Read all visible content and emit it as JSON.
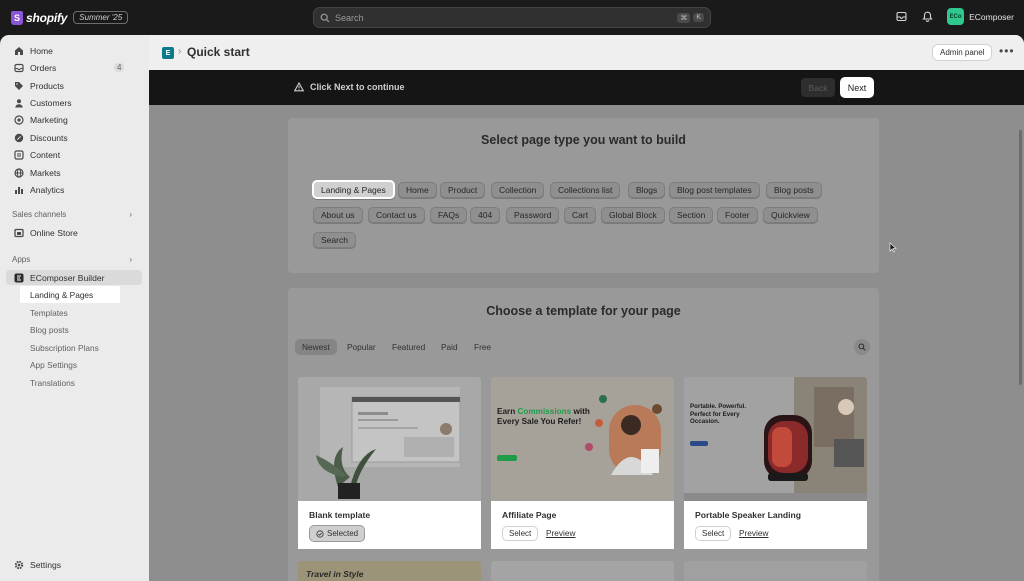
{
  "topbar": {
    "brand": "shopify",
    "edition_badge": "Summer '25",
    "search_placeholder": "Search",
    "kbd_cmd": "⌘",
    "kbd_k": "K",
    "store_avatar": "ECo",
    "store_name": "EComposer"
  },
  "sidebar": {
    "items": [
      {
        "label": "Home",
        "icon": "home-icon"
      },
      {
        "label": "Orders",
        "icon": "orders-icon",
        "badge": "4"
      },
      {
        "label": "Products",
        "icon": "tag-icon"
      },
      {
        "label": "Customers",
        "icon": "person-icon"
      },
      {
        "label": "Marketing",
        "icon": "target-icon"
      },
      {
        "label": "Discounts",
        "icon": "discount-icon"
      },
      {
        "label": "Content",
        "icon": "content-icon"
      },
      {
        "label": "Markets",
        "icon": "globe-icon"
      },
      {
        "label": "Analytics",
        "icon": "bar-chart-icon"
      }
    ],
    "sales_channels_label": "Sales channels",
    "online_store": "Online Store",
    "apps_label": "Apps",
    "app_name": "EComposer Builder",
    "app_sub_items": [
      "Landing & Pages",
      "Templates",
      "Blog posts",
      "Subscription Plans",
      "App Settings",
      "Translations"
    ],
    "settings": "Settings"
  },
  "header": {
    "title": "Quick start",
    "admin_panel": "Admin panel",
    "more": "•••"
  },
  "banner": {
    "text": "Click Next to continue",
    "back": "Back",
    "next": "Next"
  },
  "page_type": {
    "title": "Select page type you want to build",
    "chips": [
      "Landing & Pages",
      "Home",
      "Product",
      "Collection",
      "Collections list",
      "Blogs",
      "Blog post templates",
      "Blog posts",
      "About us",
      "Contact us",
      "FAQs",
      "404",
      "Password",
      "Cart",
      "Global Block",
      "Section",
      "Footer",
      "Quickview",
      "Search"
    ],
    "selected": "Landing & Pages"
  },
  "templates": {
    "title": "Choose a template for your page",
    "filters": [
      "Newest",
      "Popular",
      "Featured",
      "Paid",
      "Free"
    ],
    "active_filter": "Newest",
    "items": [
      {
        "name": "Blank template",
        "action": "Selected"
      },
      {
        "name": "Affiliate Page",
        "action": "Select",
        "preview": "Preview",
        "thumb_heading_1": "Earn ",
        "thumb_heading_highlight": "Commissions",
        "thumb_heading_2": "with Every Sale You Refer!"
      },
      {
        "name": "Portable Speaker Landing",
        "action": "Select",
        "preview": "Preview",
        "thumb_heading": "Portable. Powerful. Perfect for Every Occasion."
      }
    ],
    "next_row_thumb_text": "Travel in Style"
  },
  "colors": {
    "brand_purple": "#8a55d6",
    "store_green": "#2fc98f",
    "highlight_green": "#1f9c4a"
  }
}
